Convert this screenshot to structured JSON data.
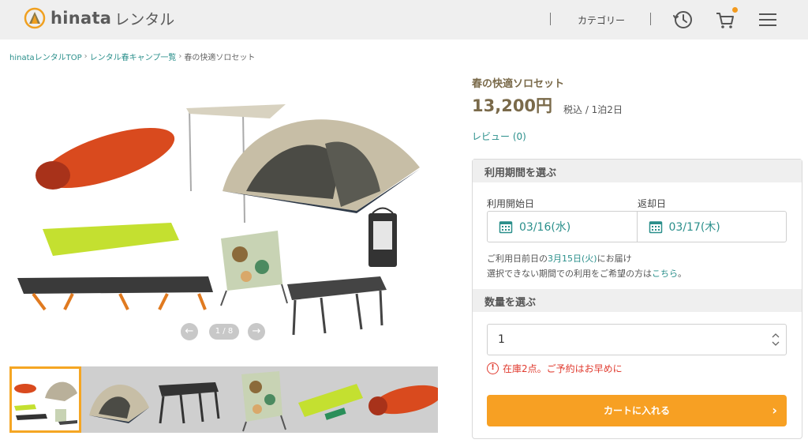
{
  "header": {
    "logo_text": "hinata",
    "logo_sub": "レンタル",
    "category_label": "カテゴリー",
    "icons": [
      "history-icon",
      "cart-icon",
      "menu-icon"
    ],
    "accent_color": "#f39a1e"
  },
  "breadcrumb": [
    {
      "label": "hinataレンタルTOP"
    },
    {
      "label": "レンタル春キャンプ一覧"
    },
    {
      "label": "春の快適ソロセット"
    }
  ],
  "gallery": {
    "counter": "1 / 8",
    "prev_icon": "arrow-left-icon",
    "next_icon": "arrow-right-icon",
    "thumbnails": [
      "camp-set",
      "dome-tent",
      "mesh-table",
      "camo-chair",
      "sleeping-mat",
      "sleeping-bag"
    ]
  },
  "product": {
    "title": "春の快適ソロセット",
    "price": "13,200円",
    "price_note": "税込 / 1泊2日",
    "review_link": "レビュー (0)"
  },
  "period": {
    "heading": "利用期間を選ぶ",
    "start_label": "利用開始日",
    "start_value": "03/16(水)",
    "return_label": "返却日",
    "return_value": "03/17(木)",
    "delivery_pre": "ご利用日前日の",
    "delivery_date": "3月15日(火)",
    "delivery_post": "にお届け",
    "unavailable_pre": "選択できない期間での利用をご希望の方は",
    "unavailable_link": "こちら",
    "unavailable_post": "。"
  },
  "quantity": {
    "heading": "数量を選ぶ",
    "value": "1",
    "stock_notice": "在庫2点。ご予約はお早めに",
    "stock_icon": "!"
  },
  "cart_button": {
    "label": "カートに入れる",
    "chevron": "›"
  }
}
